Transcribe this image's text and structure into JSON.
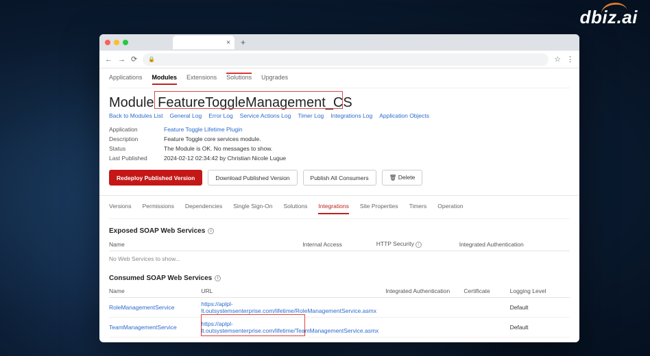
{
  "logo": "dbiz.ai",
  "browser": {
    "nav": {
      "back": "←",
      "forward": "→",
      "reload": "⟳",
      "lock": "🔒",
      "star": "☆",
      "menu": "⋮",
      "tab_close": "×",
      "tab_add": "+"
    }
  },
  "topnav": [
    "Applications",
    "Modules",
    "Extensions",
    "Solutions",
    "Upgrades"
  ],
  "topnav_active": 1,
  "heading_prefix": "Module",
  "heading_name": "FeatureToggleManagement_CS",
  "sublinks": [
    "Back to Modules List",
    "General Log",
    "Error Log",
    "Service Actions Log",
    "Timer Log",
    "Integrations Log",
    "Application Objects"
  ],
  "meta": {
    "application_label": "Application",
    "application_value": "Feature Toggle Lifetime Plugin",
    "description_label": "Description",
    "description_value": "Feature Toggle core services module.",
    "status_label": "Status",
    "status_value": "The Module is OK. No messages to show.",
    "last_published_label": "Last Published",
    "last_published_value": "2024-02-12 02:34:42  by  Christian Nicole Lugue"
  },
  "buttons": {
    "redeploy": "Redeploy Published Version",
    "download": "Download Published Version",
    "publish_all": "Publish All Consumers",
    "delete": "Delete",
    "trash": "🗑"
  },
  "subtabs": [
    "Versions",
    "Permissions",
    "Dependencies",
    "Single Sign-On",
    "Solutions",
    "Integrations",
    "Site Properties",
    "Timers",
    "Operation"
  ],
  "subtabs_active": 5,
  "exposed": {
    "title": "Exposed SOAP Web Services",
    "cols": [
      "Name",
      "Internal Access",
      "HTTP Security",
      "Integrated Authentication"
    ],
    "empty": "No Web Services to show..."
  },
  "consumed": {
    "title": "Consumed SOAP Web Services",
    "cols": [
      "Name",
      "URL",
      "Integrated Authentication",
      "Certificate",
      "Logging Level"
    ],
    "rows": [
      {
        "name": "RoleManagementService",
        "url_a": "https://aplpl-lt.outsystemsenterprise.com/",
        "url_b": "lifetime/RoleManagementService.asmx",
        "ia": "",
        "cert": "",
        "log": "Default"
      },
      {
        "name": "TeamManagementService",
        "url_a": "https://aplpl-lt.outsystemsenterprise.com/",
        "url_b": "lifetime/TeamManagementService.asmx",
        "ia": "",
        "cert": "",
        "log": "Default"
      }
    ]
  }
}
